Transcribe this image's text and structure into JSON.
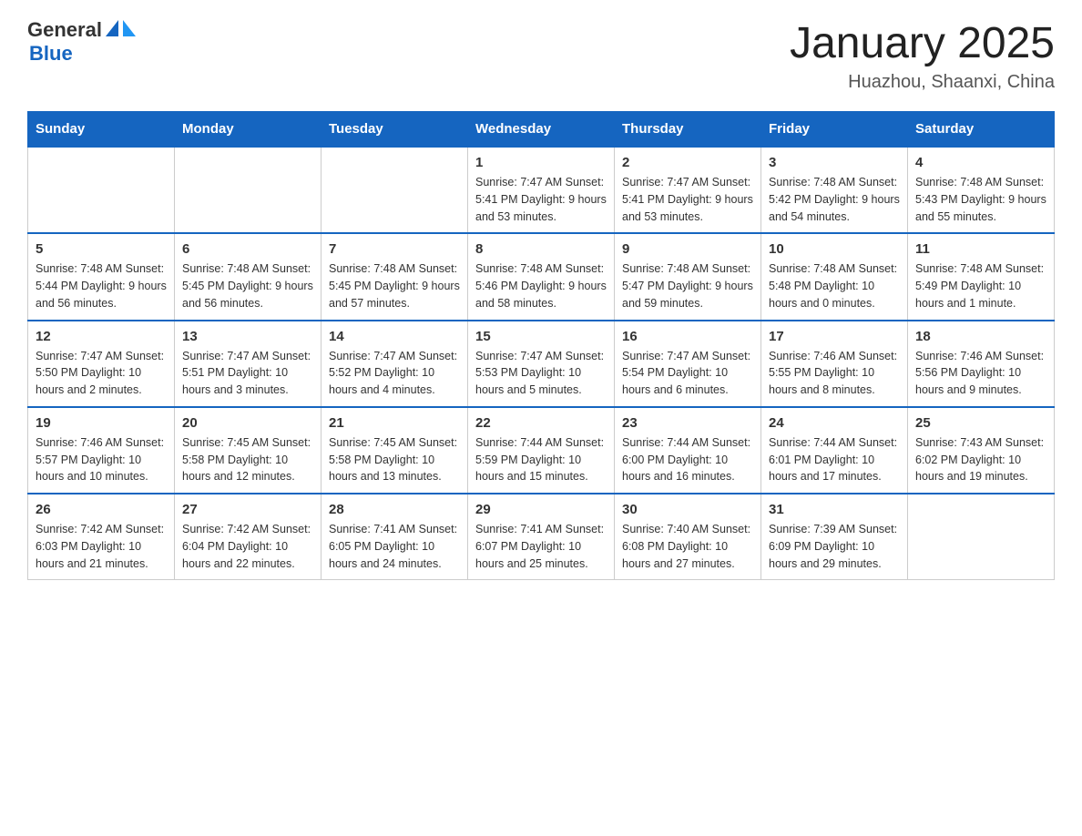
{
  "logo": {
    "text_general": "General",
    "text_blue": "Blue",
    "triangle_symbol": "▲"
  },
  "title": "January 2025",
  "subtitle": "Huazhou, Shaanxi, China",
  "days_of_week": [
    "Sunday",
    "Monday",
    "Tuesday",
    "Wednesday",
    "Thursday",
    "Friday",
    "Saturday"
  ],
  "weeks": [
    {
      "days": [
        {
          "number": "",
          "info": ""
        },
        {
          "number": "",
          "info": ""
        },
        {
          "number": "",
          "info": ""
        },
        {
          "number": "1",
          "info": "Sunrise: 7:47 AM\nSunset: 5:41 PM\nDaylight: 9 hours and 53 minutes."
        },
        {
          "number": "2",
          "info": "Sunrise: 7:47 AM\nSunset: 5:41 PM\nDaylight: 9 hours and 53 minutes."
        },
        {
          "number": "3",
          "info": "Sunrise: 7:48 AM\nSunset: 5:42 PM\nDaylight: 9 hours and 54 minutes."
        },
        {
          "number": "4",
          "info": "Sunrise: 7:48 AM\nSunset: 5:43 PM\nDaylight: 9 hours and 55 minutes."
        }
      ]
    },
    {
      "days": [
        {
          "number": "5",
          "info": "Sunrise: 7:48 AM\nSunset: 5:44 PM\nDaylight: 9 hours and 56 minutes."
        },
        {
          "number": "6",
          "info": "Sunrise: 7:48 AM\nSunset: 5:45 PM\nDaylight: 9 hours and 56 minutes."
        },
        {
          "number": "7",
          "info": "Sunrise: 7:48 AM\nSunset: 5:45 PM\nDaylight: 9 hours and 57 minutes."
        },
        {
          "number": "8",
          "info": "Sunrise: 7:48 AM\nSunset: 5:46 PM\nDaylight: 9 hours and 58 minutes."
        },
        {
          "number": "9",
          "info": "Sunrise: 7:48 AM\nSunset: 5:47 PM\nDaylight: 9 hours and 59 minutes."
        },
        {
          "number": "10",
          "info": "Sunrise: 7:48 AM\nSunset: 5:48 PM\nDaylight: 10 hours and 0 minutes."
        },
        {
          "number": "11",
          "info": "Sunrise: 7:48 AM\nSunset: 5:49 PM\nDaylight: 10 hours and 1 minute."
        }
      ]
    },
    {
      "days": [
        {
          "number": "12",
          "info": "Sunrise: 7:47 AM\nSunset: 5:50 PM\nDaylight: 10 hours and 2 minutes."
        },
        {
          "number": "13",
          "info": "Sunrise: 7:47 AM\nSunset: 5:51 PM\nDaylight: 10 hours and 3 minutes."
        },
        {
          "number": "14",
          "info": "Sunrise: 7:47 AM\nSunset: 5:52 PM\nDaylight: 10 hours and 4 minutes."
        },
        {
          "number": "15",
          "info": "Sunrise: 7:47 AM\nSunset: 5:53 PM\nDaylight: 10 hours and 5 minutes."
        },
        {
          "number": "16",
          "info": "Sunrise: 7:47 AM\nSunset: 5:54 PM\nDaylight: 10 hours and 6 minutes."
        },
        {
          "number": "17",
          "info": "Sunrise: 7:46 AM\nSunset: 5:55 PM\nDaylight: 10 hours and 8 minutes."
        },
        {
          "number": "18",
          "info": "Sunrise: 7:46 AM\nSunset: 5:56 PM\nDaylight: 10 hours and 9 minutes."
        }
      ]
    },
    {
      "days": [
        {
          "number": "19",
          "info": "Sunrise: 7:46 AM\nSunset: 5:57 PM\nDaylight: 10 hours and 10 minutes."
        },
        {
          "number": "20",
          "info": "Sunrise: 7:45 AM\nSunset: 5:58 PM\nDaylight: 10 hours and 12 minutes."
        },
        {
          "number": "21",
          "info": "Sunrise: 7:45 AM\nSunset: 5:58 PM\nDaylight: 10 hours and 13 minutes."
        },
        {
          "number": "22",
          "info": "Sunrise: 7:44 AM\nSunset: 5:59 PM\nDaylight: 10 hours and 15 minutes."
        },
        {
          "number": "23",
          "info": "Sunrise: 7:44 AM\nSunset: 6:00 PM\nDaylight: 10 hours and 16 minutes."
        },
        {
          "number": "24",
          "info": "Sunrise: 7:44 AM\nSunset: 6:01 PM\nDaylight: 10 hours and 17 minutes."
        },
        {
          "number": "25",
          "info": "Sunrise: 7:43 AM\nSunset: 6:02 PM\nDaylight: 10 hours and 19 minutes."
        }
      ]
    },
    {
      "days": [
        {
          "number": "26",
          "info": "Sunrise: 7:42 AM\nSunset: 6:03 PM\nDaylight: 10 hours and 21 minutes."
        },
        {
          "number": "27",
          "info": "Sunrise: 7:42 AM\nSunset: 6:04 PM\nDaylight: 10 hours and 22 minutes."
        },
        {
          "number": "28",
          "info": "Sunrise: 7:41 AM\nSunset: 6:05 PM\nDaylight: 10 hours and 24 minutes."
        },
        {
          "number": "29",
          "info": "Sunrise: 7:41 AM\nSunset: 6:07 PM\nDaylight: 10 hours and 25 minutes."
        },
        {
          "number": "30",
          "info": "Sunrise: 7:40 AM\nSunset: 6:08 PM\nDaylight: 10 hours and 27 minutes."
        },
        {
          "number": "31",
          "info": "Sunrise: 7:39 AM\nSunset: 6:09 PM\nDaylight: 10 hours and 29 minutes."
        },
        {
          "number": "",
          "info": ""
        }
      ]
    }
  ]
}
